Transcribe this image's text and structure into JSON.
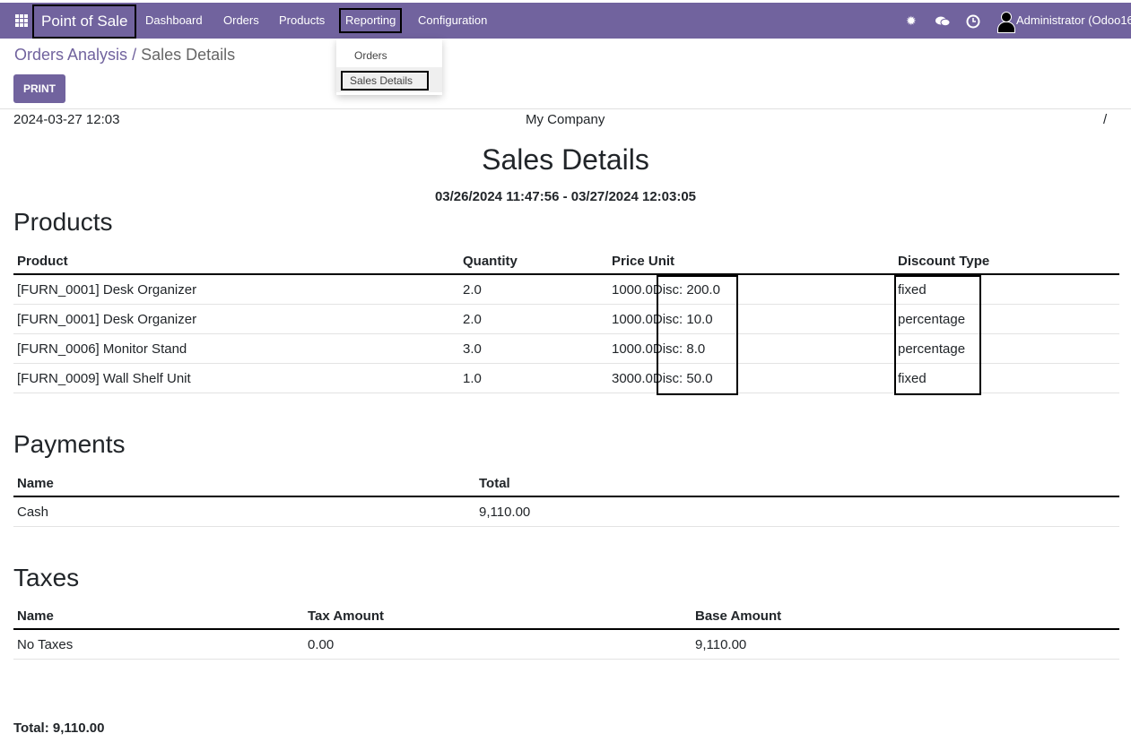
{
  "navbar": {
    "brand": "Point of Sale",
    "menu": [
      "Dashboard",
      "Orders",
      "Products",
      "Reporting",
      "Configuration"
    ],
    "user": "Administrator (Odoo16",
    "icons": [
      "apps-icon",
      "bug-icon",
      "chat-icon",
      "clock-icon",
      "user-avatar-icon"
    ]
  },
  "reporting_menu": {
    "items": [
      "Orders",
      "Sales Details"
    ]
  },
  "breadcrumb": {
    "parent": "Orders Analysis",
    "sep": "/",
    "current": "Sales Details"
  },
  "print_label": "PRINT",
  "report": {
    "date": "2024-03-27 12:03",
    "company": "My Company",
    "page": "/",
    "title": "Sales Details",
    "range": "03/26/2024 11:47:56 - 03/27/2024 12:03:05",
    "products": {
      "heading": "Products",
      "columns": [
        "Product",
        "Quantity",
        "Price Unit",
        "Discount Type"
      ],
      "rows": [
        {
          "product": "[FURN_0001] Desk Organizer",
          "qty": "2.0",
          "price": "1000.0",
          "disc": "Disc: 200.0",
          "type": "fixed"
        },
        {
          "product": "[FURN_0001] Desk Organizer",
          "qty": "2.0",
          "price": "1000.0",
          "disc": "Disc: 10.0",
          "type": "percentage"
        },
        {
          "product": "[FURN_0006] Monitor Stand",
          "qty": "3.0",
          "price": "1000.0",
          "disc": "Disc: 8.0",
          "type": "percentage"
        },
        {
          "product": "[FURN_0009] Wall Shelf Unit",
          "qty": "1.0",
          "price": "3000.0",
          "disc": "Disc: 50.0",
          "type": "fixed"
        }
      ]
    },
    "payments": {
      "heading": "Payments",
      "columns": [
        "Name",
        "Total"
      ],
      "rows": [
        {
          "name": "Cash",
          "total": "9,110.00"
        }
      ]
    },
    "taxes": {
      "heading": "Taxes",
      "columns": [
        "Name",
        "Tax Amount",
        "Base Amount"
      ],
      "rows": [
        {
          "name": "No Taxes",
          "amount": "0.00",
          "base": "9,110.00"
        }
      ]
    },
    "total": "Total: 9,110.00"
  }
}
